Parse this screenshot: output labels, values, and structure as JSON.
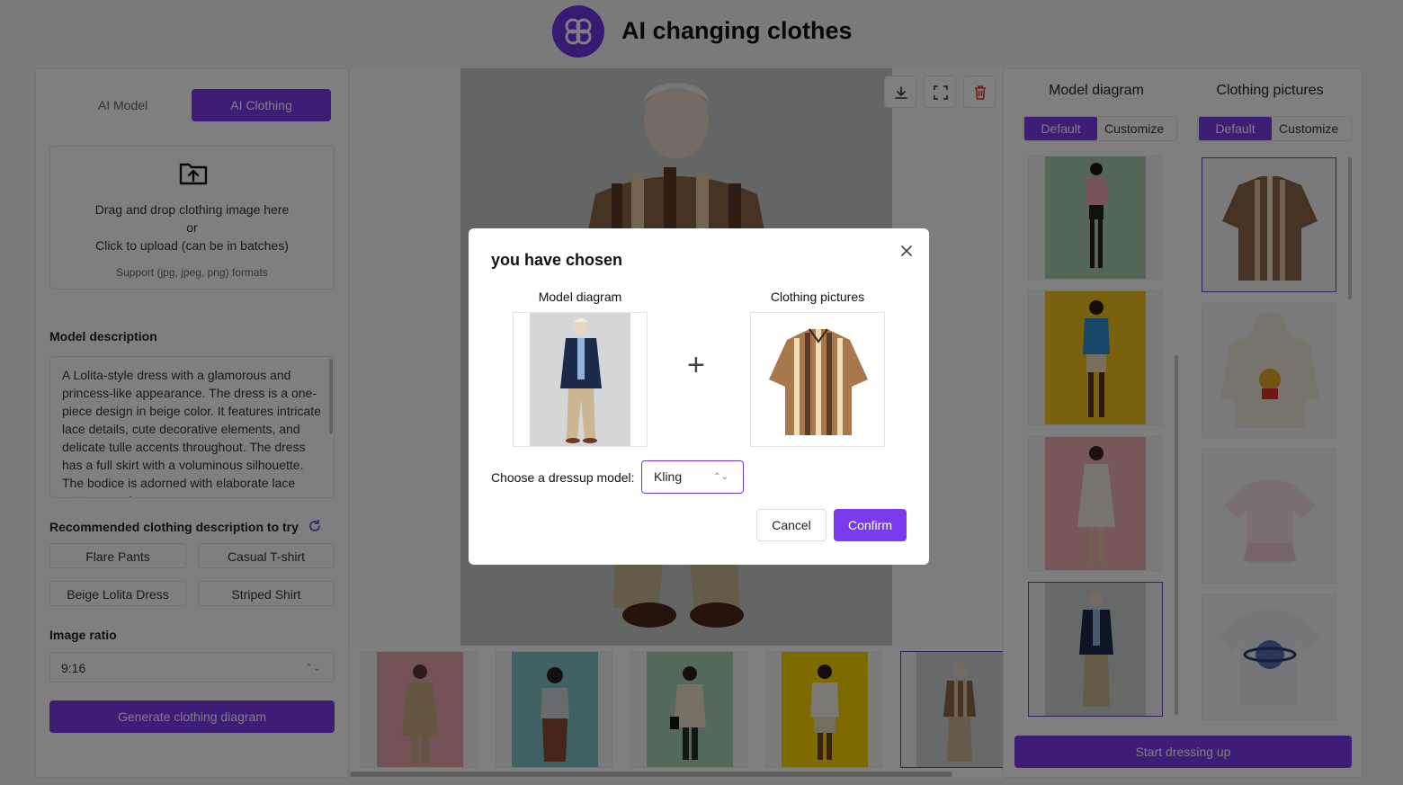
{
  "app": {
    "title": "AI changing clothes"
  },
  "left": {
    "tabs": [
      "AI Model",
      "AI Clothing"
    ],
    "upload": {
      "line1": "Drag and drop clothing image here",
      "line2": "or",
      "line3": "Click to upload (can be in batches)",
      "hint": "Support (jpg, jpeg, png) formats"
    },
    "model_description_label": "Model description",
    "model_description": "A Lolita-style dress with a glamorous and princess-like appearance. The dress is a one-piece design in beige color. It features intricate lace details, cute decorative elements, and delicate tulle accents throughout. The dress has a full skirt with a voluminous silhouette. The bodice is adorned with elaborate lace patterns and",
    "recommended_label": "Recommended clothing description to try",
    "chips": [
      "Flare Pants",
      "Casual T-shirt",
      "Beige Lolita Dress",
      "Striped Shirt"
    ],
    "ratio_label": "Image ratio",
    "ratio_value": "9:16",
    "generate_label": "Generate clothing diagram"
  },
  "right": {
    "model_title": "Model diagram",
    "clothing_title": "Clothing pictures",
    "default_label": "Default",
    "customize_label": "Customize",
    "start_label": "Start dressing up"
  },
  "modal": {
    "title": "you have chosen",
    "model_label": "Model diagram",
    "clothing_label": "Clothing pictures",
    "plus": "+",
    "choose_label": "Choose a dressup model:",
    "model_value": "Kling",
    "cancel": "Cancel",
    "confirm": "Confirm"
  },
  "colors": {
    "accent": "#7c3aed",
    "accent_border": "#6d3ad1"
  }
}
